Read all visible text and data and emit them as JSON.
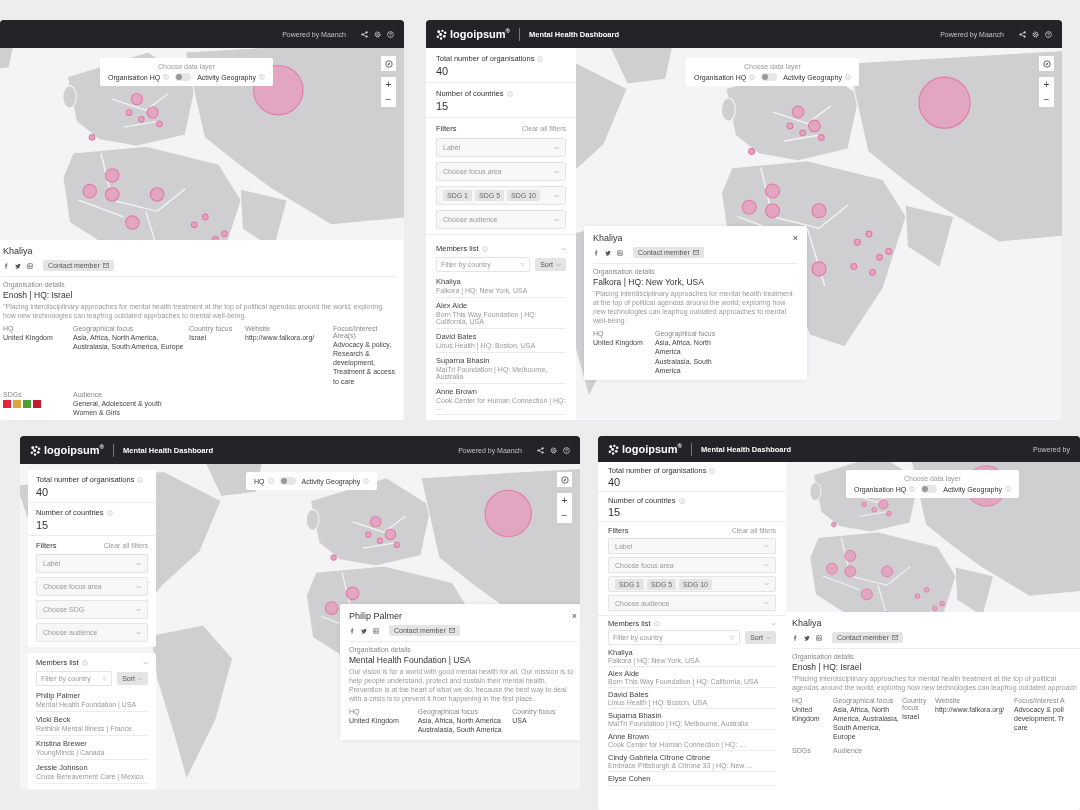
{
  "panels": [
    {
      "kind": "map_details",
      "header": {
        "powered_by": "Powered by Maanch",
        "icons": true
      },
      "data_layer": {
        "title": "Choose data layer",
        "left": "Organisation HQ",
        "right": "Activity Geography",
        "on": false
      },
      "zoom": {
        "in": "+",
        "out": "−"
      },
      "details": {
        "name": "Khaliya",
        "contact": "Contact member",
        "section": "Organisation details",
        "org": "Enosh | HQ: Israel",
        "description": "\"Placing interdisciplinary approaches for mental health treatment at the top of political agendas around the world; exploring how new technologies can leapfrog outdated approaches to mental well-being.",
        "fields": [
          {
            "label": "HQ",
            "value": "United Kingdom"
          },
          {
            "label": "Geographical focus",
            "value": "Asia, Africa, North America, Australasia, South America, Europe"
          },
          {
            "label": "Country focus",
            "value": "Israel"
          },
          {
            "label": "Website",
            "value": "http://www.falkora.org/"
          },
          {
            "label": "Focus/Interest Area(s)",
            "value": "Advocacy & policy, Research & development, Treatment & access to care"
          },
          {
            "label": "SDGs",
            "kind": "sdg",
            "tiles": [
              {
                "color": "#e5243b"
              },
              {
                "color": "#dda63a"
              },
              {
                "color": "#4c9f38"
              },
              {
                "color": "#c5192d"
              }
            ]
          },
          {
            "label": "Audience",
            "value": "General, Adolescent & youth\nWomen & Girls"
          }
        ]
      }
    },
    {
      "kind": "sidebar_popup",
      "header": {
        "logo": "logoipsum$^{®}$",
        "title": "Mental Health Dashboard",
        "powered_by": "Powered by Maanch",
        "icons": true
      },
      "sidebar": {
        "stats": [
          {
            "label": "Total number of organisations",
            "value": "40"
          },
          {
            "label": "Number of countries",
            "value": "15"
          }
        ],
        "filters": {
          "title": "Filters",
          "clear": "Clear all filters",
          "controls": [
            {
              "kind": "select",
              "placeholder": "Label"
            },
            {
              "kind": "select",
              "placeholder": "Choose focus area"
            },
            {
              "kind": "chips",
              "chips": [
                "SDG 1",
                "SDG 5",
                "SDG 10"
              ]
            },
            {
              "kind": "select",
              "placeholder": "Choose audience"
            }
          ]
        },
        "members": {
          "title": "Members list",
          "filter": "Filter by country",
          "sort": "Sort",
          "items": [
            {
              "name": "Khaliya",
              "sub": "Falkora | HQ: New York, USA"
            },
            {
              "name": "Alex Aide",
              "sub": "Born This Way Foundation | HQ: California, USA"
            },
            {
              "name": "David Bates",
              "sub": "Linus Health | HQ: Boston, USA"
            },
            {
              "name": "Suparna Bhasin",
              "sub": "MaiTri Foundation | HQ: Melbourne, Australia"
            },
            {
              "name": "Anne Brown",
              "sub": "Cook Center for Human Connection | HQ: ..."
            }
          ]
        }
      },
      "data_layer": {
        "title": "Choose data layer",
        "left": "Organisation HQ",
        "right": "Activity Geography",
        "on": false
      },
      "zoom": {
        "in": "+",
        "out": "−"
      },
      "popup": {
        "name": "Khaliya",
        "close": "×",
        "contact": "Contact member",
        "section": "Organisation details",
        "org": "Falkora | HQ: New York, USA",
        "description": "\"Placing interdisciplinary approaches for mental health treatment at the top of political agendas around the world; exploring how new technologies can leapfrog outdated approaches to mental well-being.",
        "fields": [
          {
            "label": "HQ",
            "value": "United Kingdom"
          },
          {
            "label": "Geographical focus",
            "value": "Asia, Africa, North America\nAustralasia, South America"
          }
        ]
      }
    },
    {
      "kind": "floating_popup",
      "header": {
        "logo": "logoipsum$^{®}$",
        "title": "Mental Health Dashboard",
        "powered_by": "Powered by Maanch",
        "icons": true
      },
      "sidebar": {
        "stats": [
          {
            "label": "Total number of organisations",
            "value": "40"
          },
          {
            "label": "Number of countries",
            "value": "15"
          }
        ],
        "filters": {
          "title": "Filters",
          "clear": "Clear all filters",
          "controls": [
            {
              "kind": "select",
              "placeholder": "Label"
            },
            {
              "kind": "select",
              "placeholder": "Choose focus area"
            },
            {
              "kind": "select",
              "placeholder": "Choose SDG"
            },
            {
              "kind": "select",
              "placeholder": "Choose audience"
            }
          ]
        },
        "members": {
          "title": "Members list",
          "filter": "Filter by country",
          "sort": "Sort",
          "items": [
            {
              "name": "Philip Palmer",
              "sub": "Mental Health Foundation  |  USA"
            },
            {
              "name": "Vicki Beck",
              "sub": "Rethink Mental Illness  |  France"
            },
            {
              "name": "Kristina Brewer",
              "sub": "YoungMinds  |  Canada"
            },
            {
              "name": "Jessie Johnson",
              "sub": "Cruse Bereavement Care  |  Mexico"
            }
          ]
        }
      },
      "data_layer": {
        "left": "HQ",
        "right": "Activity Geography",
        "on": false
      },
      "zoom": {
        "in": "+",
        "out": "−"
      },
      "popup": {
        "name": "Philip Palmer",
        "close": "×",
        "contact": "Contact member",
        "section": "Organisation details",
        "org": "Mental Health Foundation  |  USA",
        "description": "Our vision is for a world with good mental health for all. Our mission is to help people understand, protect and sustain their mental health. Prevention is at the heart of what we do, because the best way to deal with a crisis is to prevent it from happening in the first place.",
        "fields": [
          {
            "label": "HQ",
            "value": "United Kingdom"
          },
          {
            "label": "Geographical focus",
            "value": "Asia, Africa, North America\nAustralasia, South America"
          },
          {
            "label": "Country focus",
            "value": "USA"
          }
        ]
      }
    },
    {
      "kind": "sidebar_details",
      "header": {
        "logo": "logoipsum$^{®}$",
        "title": "Mental Health Dashboard",
        "powered_by": "Powered by",
        "icons": false
      },
      "sidebar": {
        "stats": [
          {
            "label": "Total number of organisations",
            "value": "40"
          },
          {
            "label": "Number of countries",
            "value": "15"
          }
        ],
        "filters": {
          "title": "Filters",
          "clear": "Clear all filters",
          "controls": [
            {
              "kind": "select",
              "placeholder": "Label"
            },
            {
              "kind": "select",
              "placeholder": "Choose focus area"
            },
            {
              "kind": "chips",
              "chips": [
                "SDG 1",
                "SDG 5",
                "SDG 10"
              ]
            },
            {
              "kind": "select",
              "placeholder": "Choose audience"
            }
          ]
        },
        "members": {
          "title": "Members list",
          "filter": "Filter by country",
          "sort": "Sort",
          "items": [
            {
              "name": "Khaliya",
              "sub": "Falkora | HQ: New York, USA"
            },
            {
              "name": "Alex Aide",
              "sub": "Born This Way Foundation | HQ: California, USA"
            },
            {
              "name": "David Bates",
              "sub": "Linus Health | HQ: Boston, USA"
            },
            {
              "name": "Suparna Bhasin",
              "sub": "MaiTri Foundation | HQ: Melbourne, Australia"
            },
            {
              "name": "Anne Brown",
              "sub": "Cook Center for Human Connection | HQ: ..."
            },
            {
              "name": "Cindy Gabriela Citrone Citrone",
              "sub": "Embrace Pittsburgh & Citrone 33 | HQ: New ..."
            },
            {
              "name": "Elyse Cohen"
            }
          ]
        }
      },
      "data_layer": {
        "title": "Choose data layer",
        "left": "Organisation HQ",
        "right": "Activity Geography",
        "on": false
      },
      "details": {
        "name": "Khaliya",
        "contact": "Contact member",
        "section": "Organisation details",
        "org": "Enosh | HQ: Israel",
        "description": "\"Placing interdisciplinary approaches for mental health treatment at the top of political agendas around the world; exploring how new technologies can leapfrog outdated approach",
        "fields": [
          {
            "label": "HQ",
            "value": "United Kingdom"
          },
          {
            "label": "Geographical focus",
            "value": "Asia, Africa, North America, Australasia, South America, Europe"
          },
          {
            "label": "Country focus",
            "value": "Israel"
          },
          {
            "label": "Website",
            "value": "http://www.falkora.org/"
          },
          {
            "label": "Focus/Interest A",
            "value": "Advocacy & poli\ndevelopment, Tr\ncare"
          },
          {
            "label": "SDGs"
          },
          {
            "label": "Audience"
          }
        ]
      }
    }
  ]
}
